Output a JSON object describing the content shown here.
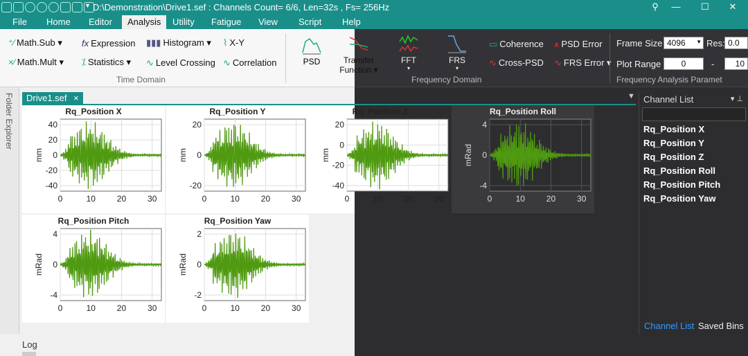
{
  "titlebar": {
    "title": "D:\\Demonstration\\Drive1.sef : Channels Count= 6/6, Len=32s , Fs= 256Hz",
    "pin_icon": "pin-icon",
    "minimize_icon": "minimize-icon",
    "maximize_icon": "maximize-icon",
    "close_icon": "close-icon"
  },
  "menu": {
    "file": "File",
    "home": "Home",
    "editor": "Editor",
    "analysis": "Analysis",
    "utility": "Utility",
    "fatigue": "Fatigue",
    "view": "View",
    "script": "Script",
    "help": "Help"
  },
  "ribbon": {
    "time_domain": {
      "math_sub": "Math.Sub",
      "math_mult": "Math.Mult",
      "expression": "Expression",
      "statistics": "Statistics",
      "histogram": "Histogram",
      "level_crossing": "Level Crossing",
      "xy": "X-Y",
      "correlation": "Correlation",
      "group_label": "Time Domain"
    },
    "frequency_domain": {
      "psd": "PSD",
      "transfer_function_1": "Transfer",
      "transfer_function_2": "Function",
      "fft": "FFT",
      "frs": "FRS",
      "coherence": "Coherence",
      "cross_psd": "Cross-PSD",
      "psd_error": "PSD Error",
      "frs_error": "FRS Error",
      "group_label": "Frequency Domain"
    },
    "params": {
      "frame_size_label": "Frame Size :",
      "frame_size_value": "4096",
      "res_label": "Res:",
      "res_value": "0.0",
      "plot_range_label": "Plot Range :",
      "plot_range_from": "0",
      "plot_range_dash": "-",
      "plot_range_to": "10",
      "group_label": "Frequency Analysis Paramet"
    }
  },
  "folder_explorer": "Folder Explorer",
  "doc_tab": {
    "label": "Drive1.sef",
    "close": "×"
  },
  "plots": [
    {
      "title": "Rq_Position X",
      "ylabel": "mm",
      "yticks": [
        "40",
        "20",
        "0",
        "-20",
        "-40"
      ],
      "xticks": [
        "0",
        "10",
        "20",
        "30"
      ]
    },
    {
      "title": "Rq_Position Y",
      "ylabel": "mm",
      "yticks": [
        "20",
        "0",
        "-20"
      ],
      "xticks": [
        "0",
        "10",
        "20",
        "30"
      ]
    },
    {
      "title": "Rq_Position Z",
      "ylabel": "mm",
      "yticks": [
        "20",
        "0",
        "-20",
        "-40"
      ],
      "xticks": [
        "0",
        "10",
        "20",
        "30"
      ]
    },
    {
      "title": "Rq_Position Roll",
      "ylabel": "mRad",
      "yticks": [
        "4",
        "0",
        "-4"
      ],
      "xticks": [
        "0",
        "10",
        "20",
        "30"
      ]
    },
    {
      "title": "Rq_Position Pitch",
      "ylabel": "mRad",
      "yticks": [
        "4",
        "0",
        "-4"
      ],
      "xticks": [
        "0",
        "10",
        "20",
        "30"
      ]
    },
    {
      "title": "Rq_Position Yaw",
      "ylabel": "mRad",
      "yticks": [
        "2",
        "0",
        "-2"
      ],
      "xticks": [
        "0",
        "10",
        "20",
        "30"
      ]
    }
  ],
  "channel_panel": {
    "title": "Channel List",
    "items": [
      "Rq_Position X",
      "Rq_Position Y",
      "Rq_Position Z",
      "Rq_Position Roll",
      "Rq_Position Pitch",
      "Rq_Position Yaw"
    ],
    "tab_channel_list": "Channel List",
    "tab_saved_bins": "Saved Bins"
  },
  "log": "Log",
  "colors": {
    "accent": "#1a8f8a",
    "trace": "#4f9a10",
    "tab_active_text": "#3399ff"
  }
}
